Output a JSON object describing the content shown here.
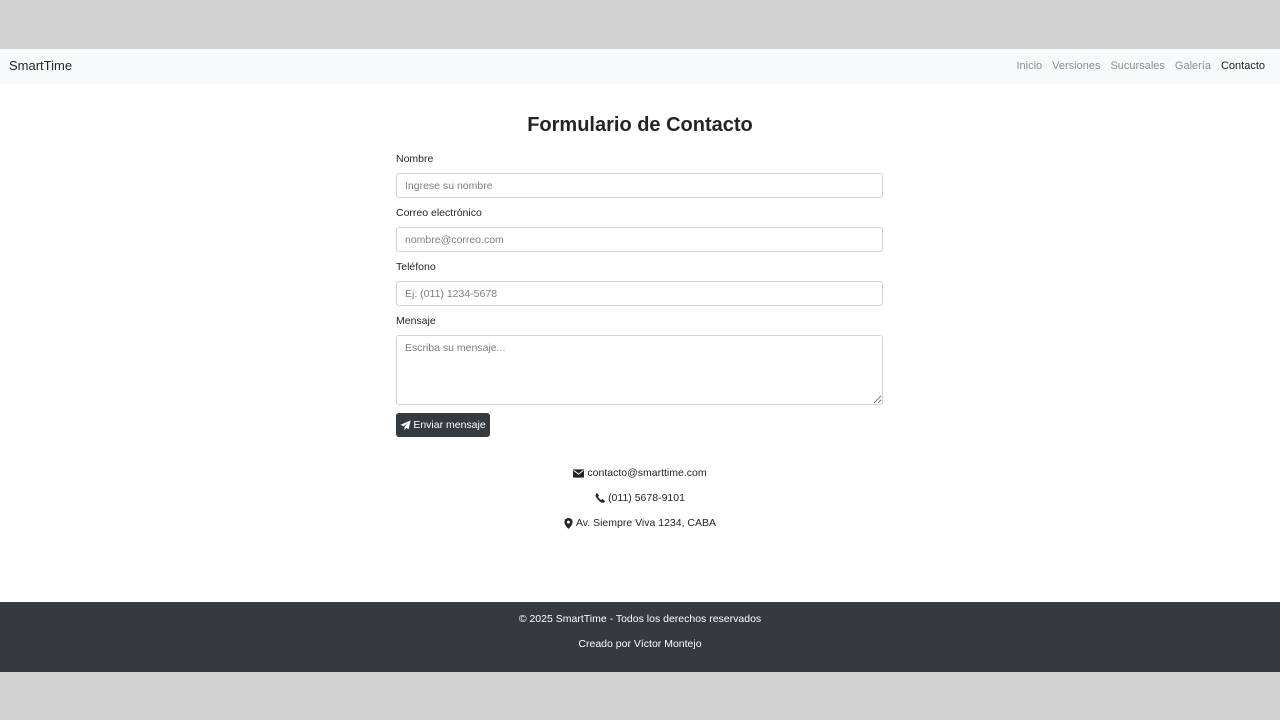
{
  "navbar": {
    "brand": "SmartTime",
    "items": [
      {
        "label": "Inicio"
      },
      {
        "label": "Versiones"
      },
      {
        "label": "Sucursales"
      },
      {
        "label": "Galería"
      },
      {
        "label": "Contacto"
      }
    ],
    "active": "Contacto"
  },
  "main": {
    "title": "Formulario de Contacto",
    "form": {
      "name": {
        "label": "Nombre",
        "placeholder": "Ingrese su nombre"
      },
      "email": {
        "label": "Correo electrónico",
        "placeholder": "nombre@correo.com"
      },
      "phone": {
        "label": "Teléfono",
        "placeholder": "Ej: (011) 1234-5678"
      },
      "message": {
        "label": "Mensaje",
        "placeholder": "Escriba su mensaje..."
      },
      "submit_label": "Enviar mensaje",
      "submit_icon": "paper-plane-icon"
    },
    "contact_info": {
      "email": {
        "icon": "envelope-icon",
        "text": "contacto@smarttime.com"
      },
      "phone": {
        "icon": "phone-icon",
        "text": "(011) 5678-9101"
      },
      "address": {
        "icon": "map-marker-icon",
        "text": "Av. Siempre Viva 1234, CABA"
      }
    }
  },
  "footer": {
    "copyright": "© 2025 SmartTime - Todos los derechos reservados",
    "credit": "Creado por Víctor Montejo"
  },
  "colors": {
    "outer_background": "#d3d3d3",
    "navbar_background": "#f8f9fa",
    "footer_background": "#343a40",
    "button_background": "#343a40"
  }
}
